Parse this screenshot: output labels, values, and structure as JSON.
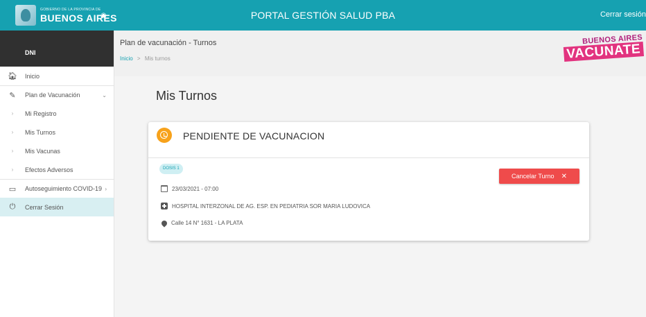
{
  "topbar": {
    "logo_small": "Gobierno de la Provincia de",
    "logo_big": "BUENOS AIRES",
    "portal_title": "PORTAL GESTIÓN SALUD PBA",
    "logout_label": "Cerrar sesión"
  },
  "sidebar": {
    "header": "DNI",
    "items": [
      {
        "label": "Inicio",
        "icon": "home-icon"
      },
      {
        "label": "Plan de Vacunación",
        "icon": "syringe-icon"
      },
      {
        "label": "Mi Registro",
        "icon": "chevron-right-icon"
      },
      {
        "label": "Mis Turnos",
        "icon": "chevron-right-icon"
      },
      {
        "label": "Mis Vacunas",
        "icon": "chevron-right-icon"
      },
      {
        "label": "Efectos Adversos",
        "icon": "chevron-right-icon"
      },
      {
        "label": "Autoseguimiento COVID-19",
        "icon": "calendar-icon"
      },
      {
        "label": "Cerrar Sesión",
        "icon": "power-icon"
      }
    ]
  },
  "page": {
    "title": "Plan de vacunación - Turnos",
    "breadcrumb_home": "Inicio",
    "breadcrumb_sep": ">",
    "breadcrumb_current": "Mis turnos",
    "brand_top": "BUENOS AIRES",
    "brand_bottom": "VACUNATE"
  },
  "main": {
    "heading": "Mis Turnos"
  },
  "card": {
    "status": "PENDIENTE DE VACUNACION",
    "status_color": "#f7a21b",
    "dosis": "DOSIS 1",
    "datetime": "23/03/2021 - 07:00",
    "hospital": "HOSPITAL INTERZONAL DE AG. ESP. EN PEDIATRIA SOR MARIA LUDOVICA",
    "address": "Calle 14 N° 1631 - LA PLATA",
    "cancel_label": "Cancelar Turno",
    "cancel_icon": "✕",
    "cancel_color": "#ef4b4b"
  },
  "colors": {
    "accent": "#16a1b1",
    "sidebar_header": "#303030"
  }
}
